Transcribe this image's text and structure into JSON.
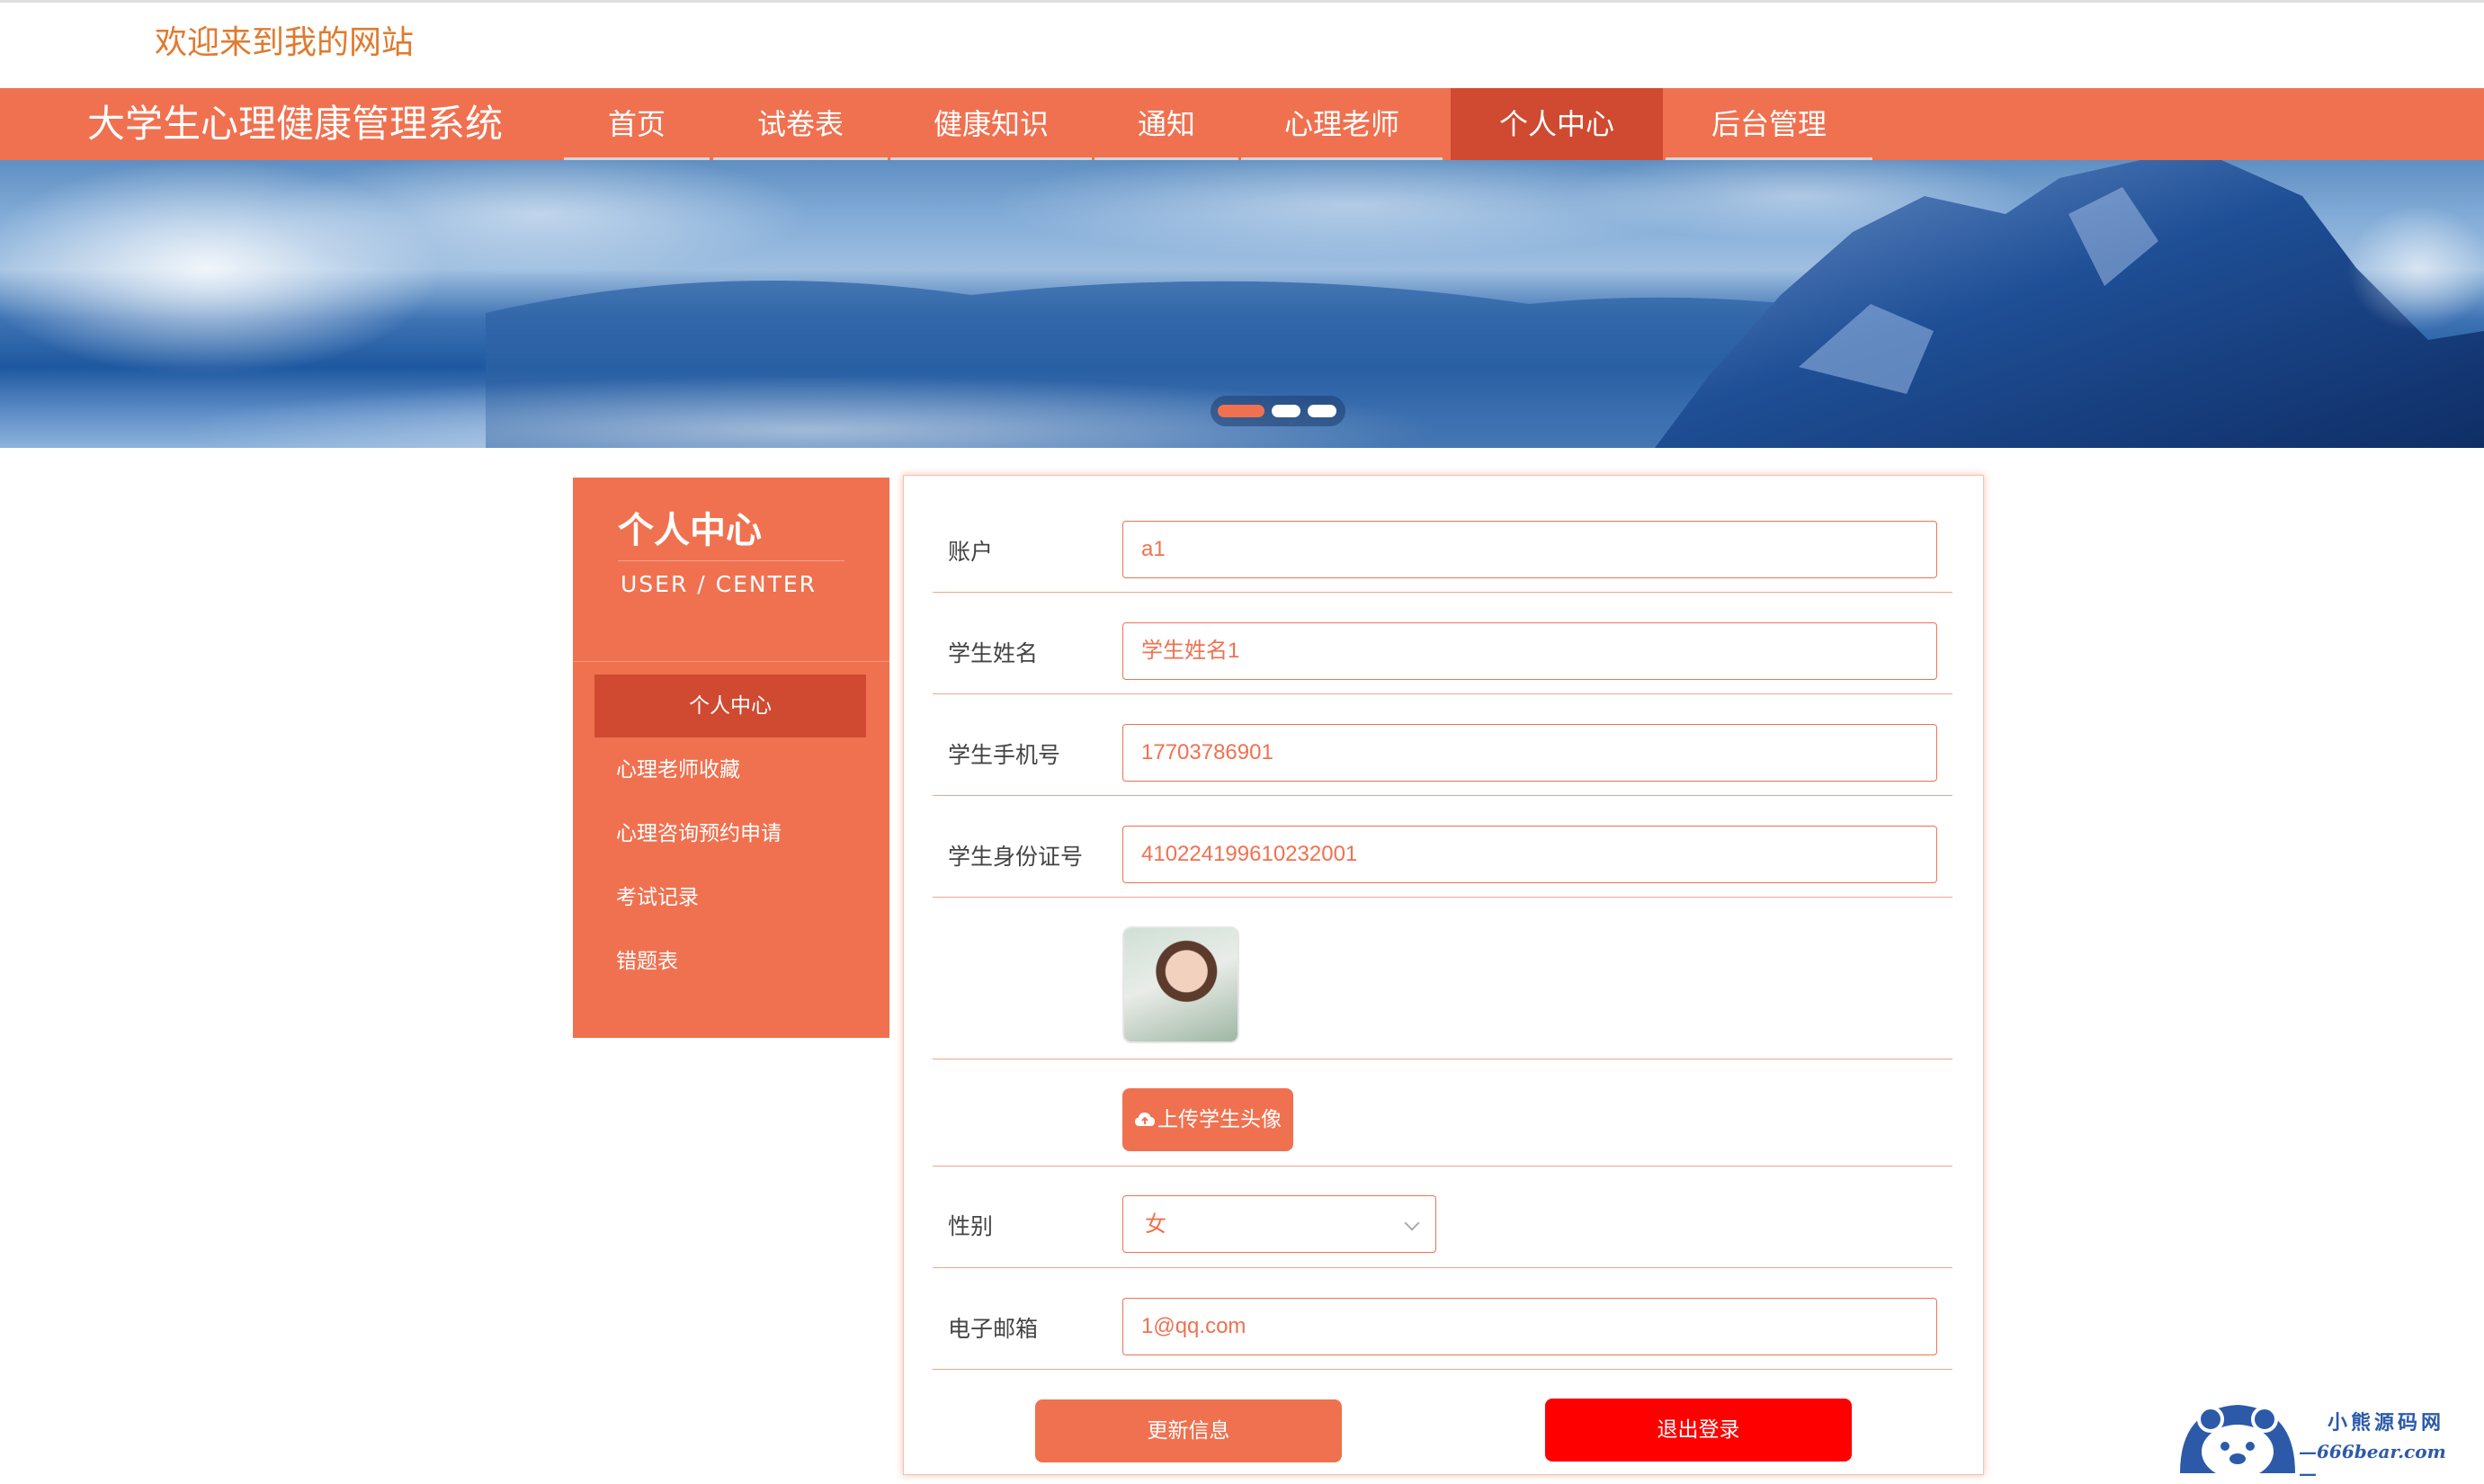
{
  "header": {
    "welcome": "欢迎来到我的网站"
  },
  "nav": {
    "site_title": "大学生心理健康管理系统",
    "items": [
      {
        "label": "首页"
      },
      {
        "label": "试卷表"
      },
      {
        "label": "健康知识"
      },
      {
        "label": "通知"
      },
      {
        "label": "心理老师"
      },
      {
        "label": "个人中心",
        "active": true
      },
      {
        "label": "后台管理"
      }
    ]
  },
  "carousel": {
    "slide_count": 3,
    "active_index": 0
  },
  "sidebar": {
    "title": "个人中心",
    "subtitle": "USER / CENTER",
    "items": [
      {
        "label": "个人中心",
        "active": true
      },
      {
        "label": "心理老师收藏"
      },
      {
        "label": "心理咨询预约申请"
      },
      {
        "label": "考试记录"
      },
      {
        "label": "错题表"
      }
    ]
  },
  "form": {
    "account": {
      "label": "账户",
      "value": "a1"
    },
    "name": {
      "label": "学生姓名",
      "value": "学生姓名1"
    },
    "phone": {
      "label": "学生手机号",
      "value": "17703786901"
    },
    "id_card": {
      "label": "学生身份证号",
      "value": "410224199610232001"
    },
    "upload_label": "上传学生头像",
    "gender": {
      "label": "性别",
      "value": "女"
    },
    "email": {
      "label": "电子邮箱",
      "value": "1@qq.com"
    },
    "update_label": "更新信息",
    "logout_label": "退出登录"
  },
  "watermark": {
    "title": "小熊源码网",
    "url": "666bear.com"
  },
  "colors": {
    "primary": "#f07150",
    "primary_dark": "#cf4a31",
    "danger": "#ff0000",
    "welcome": "#e07a2e"
  }
}
